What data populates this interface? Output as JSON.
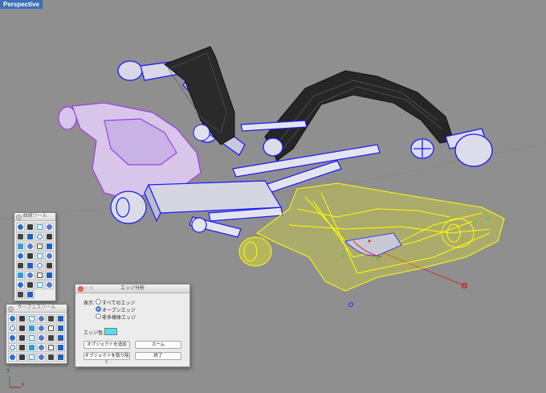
{
  "viewport": {
    "label": "Perspective",
    "colors": {
      "background": "#8f8f8f",
      "selection_highlight": "#ffff00",
      "naked_edges": "#1a1aff",
      "purple_part": "#9f3fe0",
      "black_part": "#111111"
    }
  },
  "palettes": [
    {
      "title": "曲線ツール",
      "icon_count": 30
    },
    {
      "title": "サーフェスツール",
      "icon_count": 30
    }
  ],
  "edge_dialog": {
    "title": "エッジ分析",
    "display_label": "表示:",
    "options": [
      {
        "label": "すべてのエッジ",
        "selected": false
      },
      {
        "label": "オープンエッジ",
        "selected": true
      },
      {
        "label": "非多様体エッジ",
        "selected": false
      }
    ],
    "edge_color_label": "エッジ色:",
    "edge_color": "#4fe1f3",
    "buttons": {
      "add_objects": "オブジェクトを追加",
      "zoom": "ズーム",
      "remove_objects": "オブジェクトを取り除く",
      "close": "終了"
    }
  },
  "axis_labels": {
    "y": "y",
    "x": "x"
  }
}
